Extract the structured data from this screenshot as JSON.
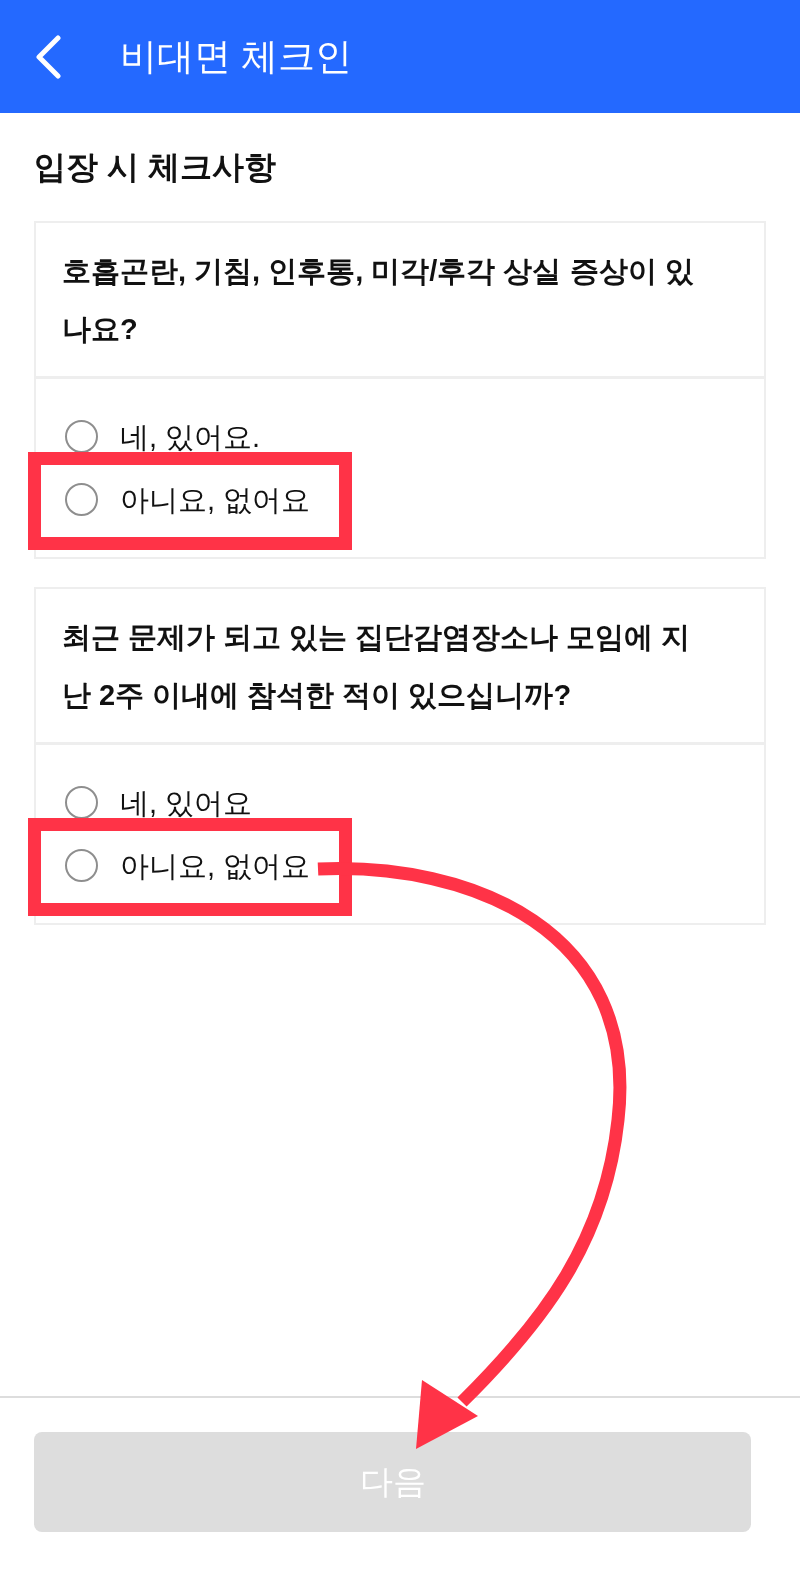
{
  "header": {
    "title": "비대면 체크인"
  },
  "section_title": "입장 시 체크사항",
  "questions": [
    {
      "text": "호흡곤란, 기침, 인후통, 미각/후각 상실 증상이 있나요?",
      "options": [
        {
          "label": "네, 있어요.",
          "selected": false,
          "highlighted": false
        },
        {
          "label": "아니요, 없어요",
          "selected": false,
          "highlighted": true
        }
      ]
    },
    {
      "text": "최근 문제가 되고 있는 집단감염장소나 모임에 지난 2주 이내에 참석한 적이 있으십니까?",
      "options": [
        {
          "label": "네, 있어요",
          "selected": false,
          "highlighted": false
        },
        {
          "label": "아니요, 없어요",
          "selected": false,
          "highlighted": true
        }
      ]
    }
  ],
  "next_button": {
    "label": "다음",
    "disabled": true
  }
}
